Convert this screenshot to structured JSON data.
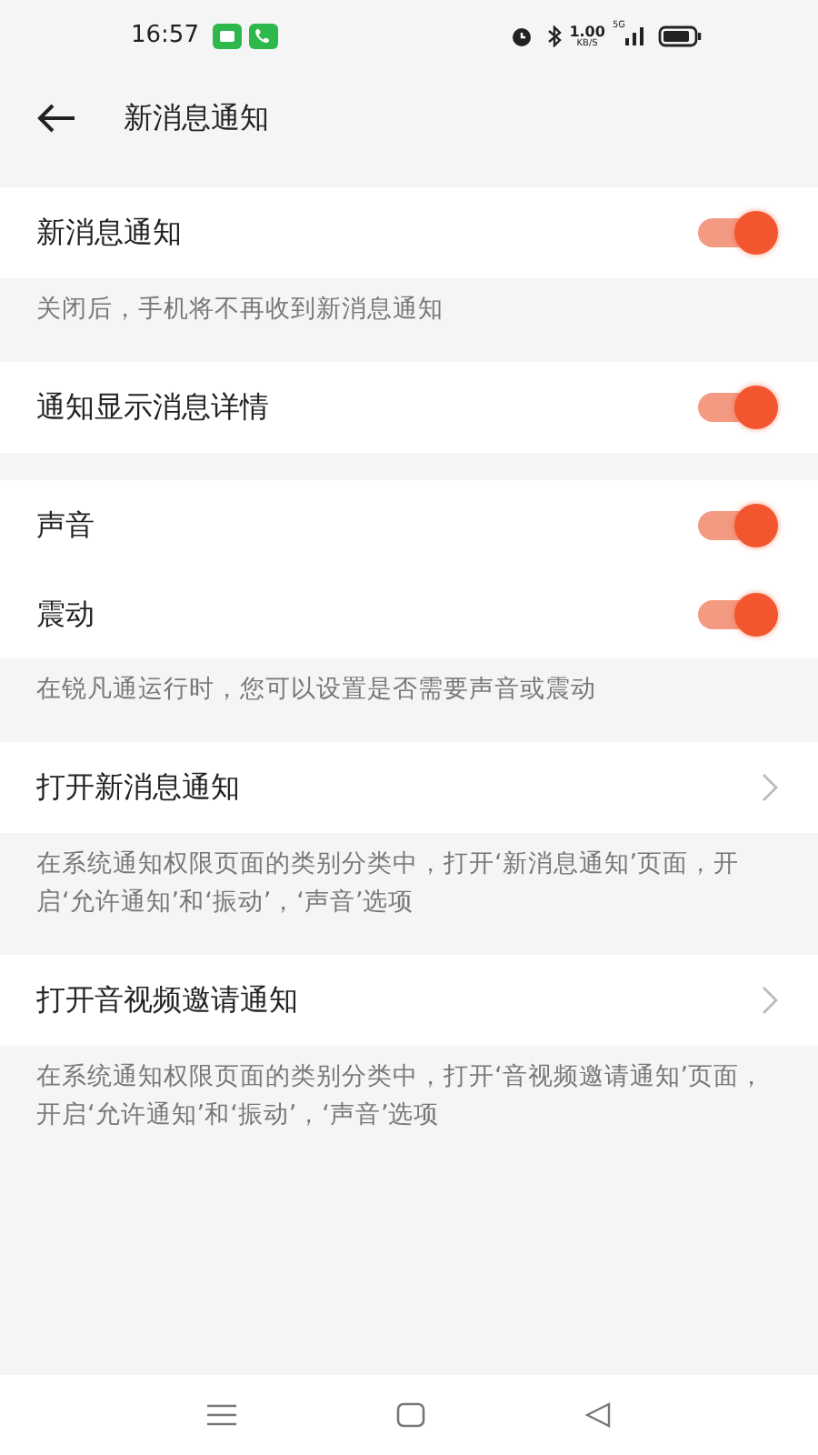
{
  "status_bar": {
    "time": "16:57",
    "speed_value": "1.00",
    "speed_unit": "KB/S",
    "network": "5G"
  },
  "header": {
    "title": "新消息通知"
  },
  "sections": [
    {
      "rows": [
        {
          "kind": "toggle",
          "label": "新消息通知",
          "on": true
        }
      ],
      "note": "关闭后，手机将不再收到新消息通知"
    },
    {
      "rows": [
        {
          "kind": "toggle",
          "label": "通知显示消息详情",
          "on": true
        }
      ]
    },
    {
      "rows": [
        {
          "kind": "toggle",
          "label": "声音",
          "on": true
        },
        {
          "kind": "toggle",
          "label": "震动",
          "on": true
        }
      ],
      "note": "在锐凡通运行时，您可以设置是否需要声音或震动"
    },
    {
      "rows": [
        {
          "kind": "link",
          "label": "打开新消息通知"
        }
      ],
      "note": "在系统通知权限页面的类别分类中，打开‘新消息通知’页面，开启‘允许通知’和‘振动’，‘声音’选项"
    },
    {
      "rows": [
        {
          "kind": "link",
          "label": "打开音视频邀请通知"
        }
      ],
      "note": "在系统通知权限页面的类别分类中，打开‘音视频邀请通知’页面，开启‘允许通知’和‘振动’，‘声音’选项"
    }
  ]
}
